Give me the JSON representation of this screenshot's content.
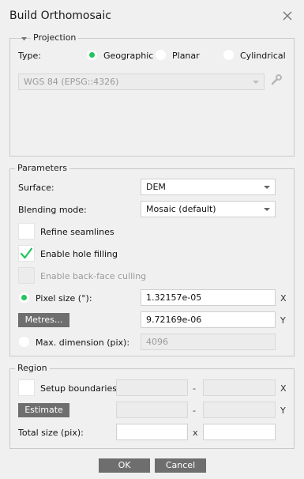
{
  "dialog": {
    "title": "Build Orthomosaic"
  },
  "projection": {
    "legend": "Projection",
    "type_label": "Type:",
    "options": [
      "Geographic",
      "Planar",
      "Cylindrical"
    ],
    "selected": "Geographic",
    "crs_value": "WGS 84 (EPSG::4326)"
  },
  "parameters": {
    "legend": "Parameters",
    "surface_label": "Surface:",
    "surface_value": "DEM",
    "blending_label": "Blending mode:",
    "blending_value": "Mosaic (default)",
    "refine_label": "Refine seamlines",
    "refine_checked": false,
    "hole_label": "Enable hole filling",
    "hole_checked": true,
    "backface_label": "Enable back-face culling",
    "backface_checked": false,
    "pixel_size_label": "Pixel size (°):",
    "pixel_x": "1.32157e-05",
    "pixel_y": "9.72169e-06",
    "metres_button": "Metres...",
    "max_dim_label": "Max. dimension (pix):",
    "max_dim_value": "4096",
    "x_axis": "X",
    "y_axis": "Y"
  },
  "region": {
    "legend": "Region",
    "setup_label": "Setup boundaries:",
    "estimate_button": "Estimate",
    "total_label": "Total size (pix):",
    "dash": "-",
    "times": "x",
    "x_axis": "X",
    "y_axis": "Y"
  },
  "footer": {
    "ok": "OK",
    "cancel": "Cancel"
  },
  "colors": {
    "accent_radio": "#22c55e",
    "check_mark": "#22c55e",
    "button_bg": "#6e6e6e"
  }
}
